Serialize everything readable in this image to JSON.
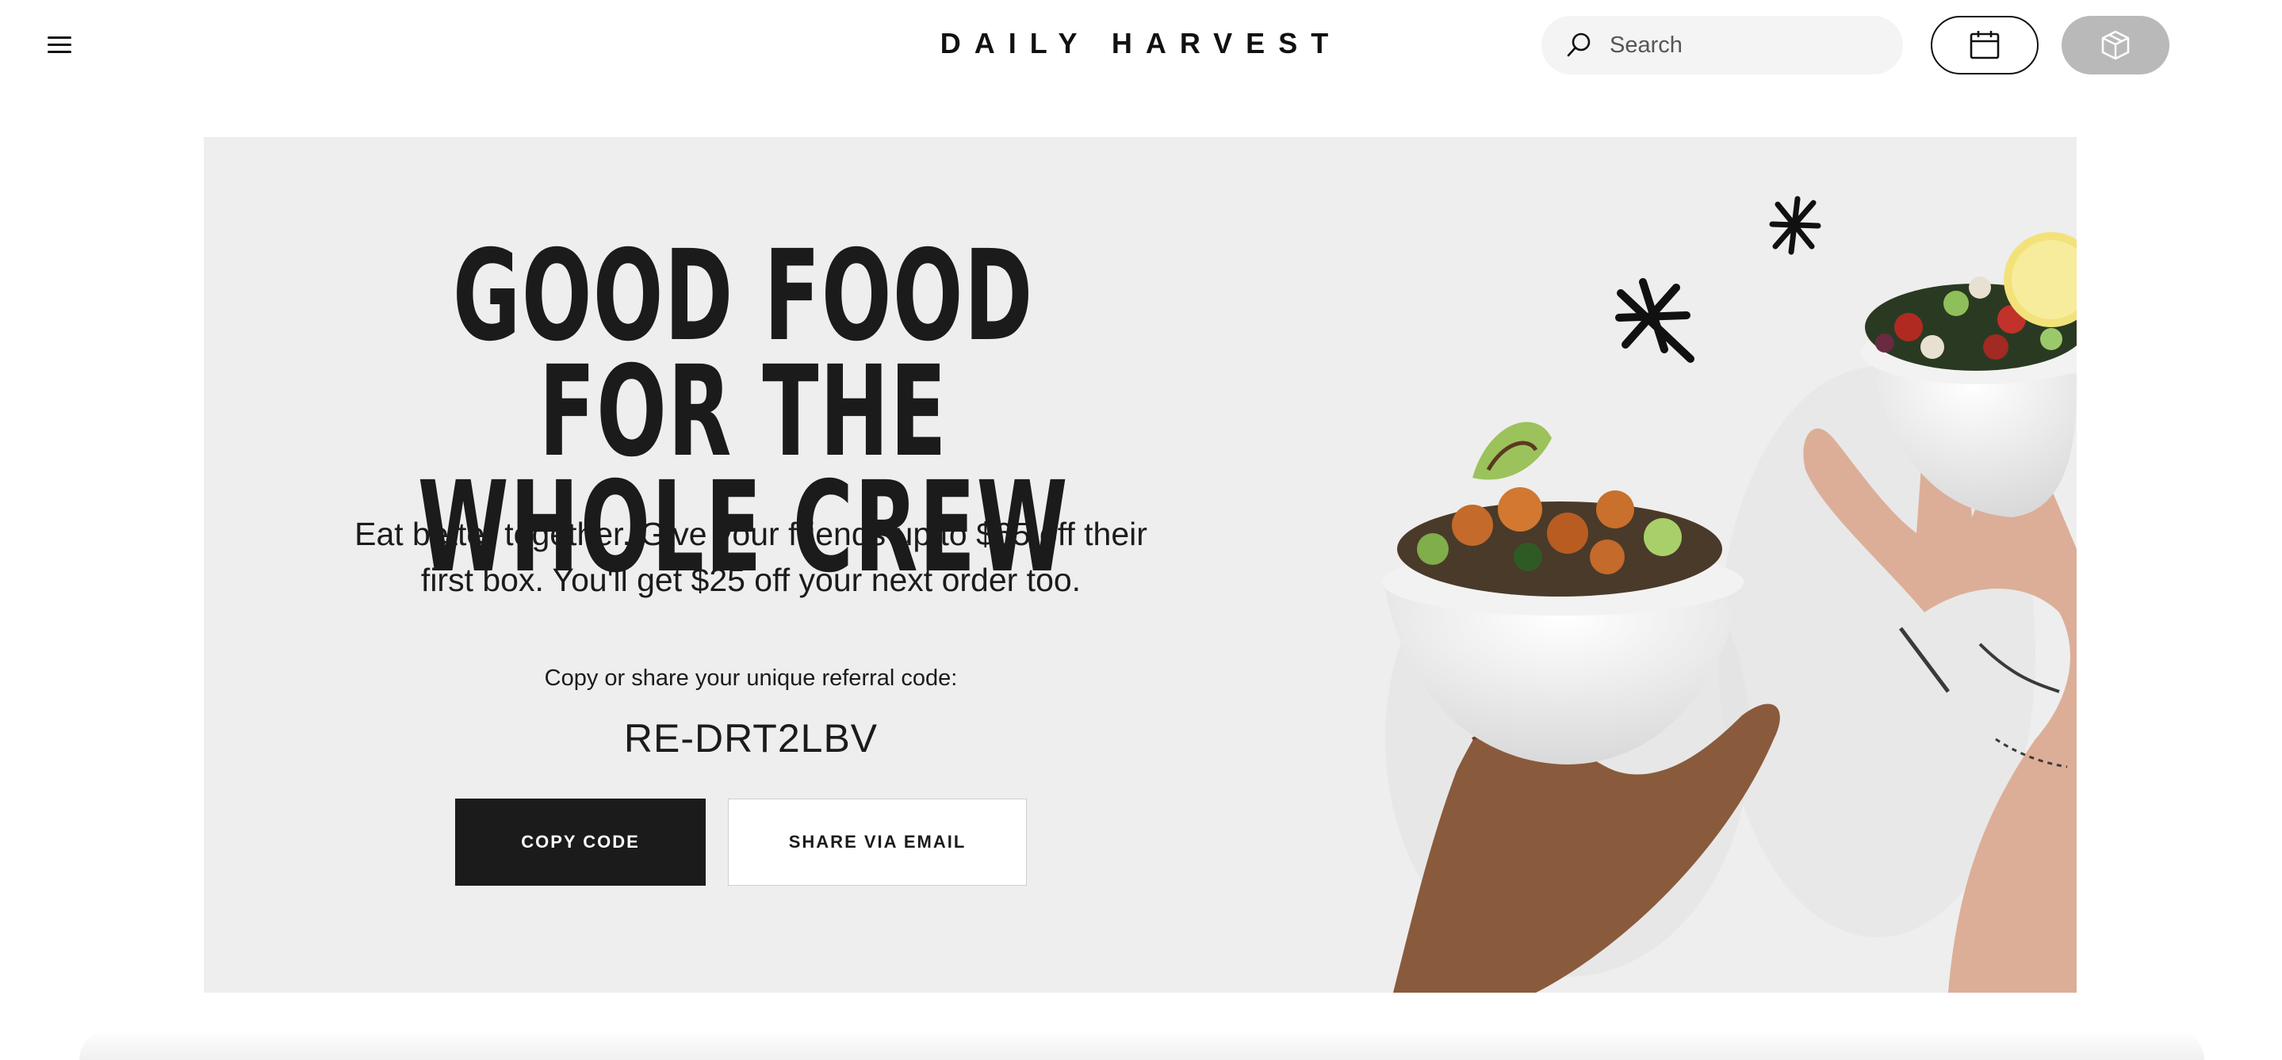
{
  "header": {
    "brand": "DAILY HARVEST",
    "search": {
      "placeholder": "Search",
      "value": ""
    },
    "icons": {
      "menu": "hamburger-menu-icon",
      "search": "search-icon",
      "delivery": "calendar-icon",
      "box": "box-icon"
    }
  },
  "hero": {
    "headline_line1": "GOOD FOOD FOR THE",
    "headline_line2": "WHOLE CREW",
    "subhead_line1": "Eat better together. Give your friends up to $65 off their",
    "subhead_line2": "first box. You'll get $25 off your next order too.",
    "code_label": "Copy or share your unique referral code:",
    "referral_code": "RE-DRT2LBV",
    "copy_button": "COPY CODE",
    "share_button": "SHARE VIA EMAIL"
  },
  "colors": {
    "hero_bg": "#eeeeee",
    "primary_button": "#1b1b1b",
    "box_button": "#b9b9b9",
    "search_bg": "#f4f4f4"
  }
}
